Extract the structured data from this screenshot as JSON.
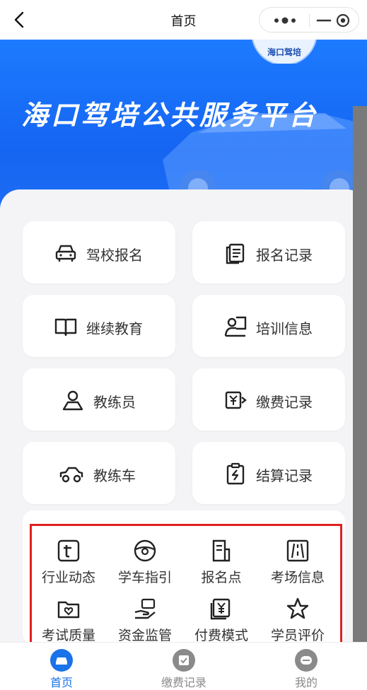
{
  "nav": {
    "title": "首页"
  },
  "banner": {
    "title": "海口驾培公共服务平台",
    "logo_text": "海口驾培"
  },
  "menu_cards": [
    {
      "label": "驾校报名",
      "icon": "car-front-icon"
    },
    {
      "label": "报名记录",
      "icon": "document-list-icon"
    },
    {
      "label": "继续教育",
      "icon": "open-book-icon"
    },
    {
      "label": "培训信息",
      "icon": "trainer-board-icon"
    },
    {
      "label": "教练员",
      "icon": "person-icon"
    },
    {
      "label": "缴费记录",
      "icon": "payment-yen-icon"
    },
    {
      "label": "教练车",
      "icon": "car-side-icon"
    },
    {
      "label": "结算记录",
      "icon": "settlement-clipboard-icon"
    }
  ],
  "grid_items": [
    {
      "label": "行业动态",
      "icon": "news-t-icon"
    },
    {
      "label": "学车指引",
      "icon": "steering-wheel-icon"
    },
    {
      "label": "报名点",
      "icon": "location-doc-icon"
    },
    {
      "label": "考场信息",
      "icon": "road-icon"
    },
    {
      "label": "考试质量",
      "icon": "folder-heart-icon"
    },
    {
      "label": "资金监管",
      "icon": "hand-money-icon"
    },
    {
      "label": "付费模式",
      "icon": "yen-card-icon"
    },
    {
      "label": "学员评价",
      "icon": "star-icon"
    }
  ],
  "tabs": [
    {
      "label": "首页",
      "active": true,
      "icon": "home-car-icon"
    },
    {
      "label": "缴费记录",
      "active": false,
      "icon": "payment-icon"
    },
    {
      "label": "我的",
      "active": false,
      "icon": "profile-icon"
    }
  ],
  "colors": {
    "brand_blue": "#1d6ff7",
    "tab_active": "#1a73e8",
    "tab_inactive": "#8a8a8a",
    "highlight_red": "#e02020"
  }
}
